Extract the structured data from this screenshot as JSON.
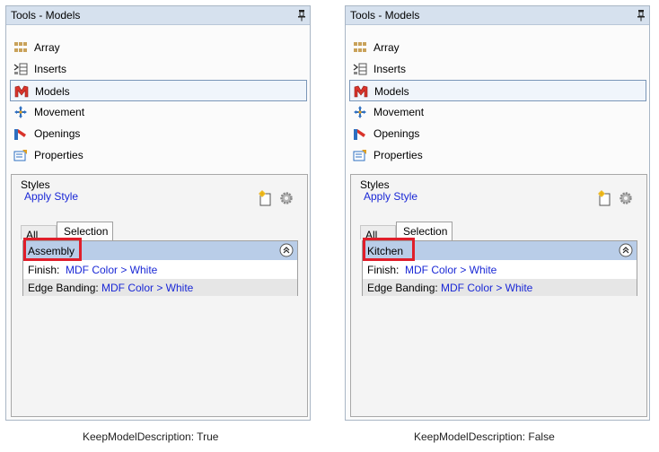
{
  "panels": [
    {
      "title": "Tools - Models",
      "menu": [
        "Array",
        "Inserts",
        "Models",
        "Movement",
        "Openings",
        "Properties"
      ],
      "selected_menu": "Models",
      "styles": {
        "label": "Styles",
        "apply_link": "Apply Style"
      },
      "tabs": {
        "all": "All",
        "selection": "Selection"
      },
      "group_header": "Assembly",
      "rows": [
        {
          "key": "Finish:",
          "value": "MDF Color > White"
        },
        {
          "key": "Edge Banding:",
          "value": "MDF Color > White"
        }
      ],
      "caption": "KeepModelDescription: True"
    },
    {
      "title": "Tools - Models",
      "menu": [
        "Array",
        "Inserts",
        "Models",
        "Movement",
        "Openings",
        "Properties"
      ],
      "selected_menu": "Models",
      "styles": {
        "label": "Styles",
        "apply_link": "Apply Style"
      },
      "tabs": {
        "all": "All",
        "selection": "Selection"
      },
      "group_header": "Kitchen",
      "rows": [
        {
          "key": "Finish:",
          "value": "MDF Color > White"
        },
        {
          "key": "Edge Banding:",
          "value": "MDF Color > White"
        }
      ],
      "caption": "KeepModelDescription: False"
    }
  ],
  "colors": {
    "highlight_box": "#e01e2a",
    "link": "#1a28d6",
    "header_bg": "#b9cde8"
  },
  "icons": [
    "array-icon",
    "inserts-icon",
    "models-icon",
    "movement-icon",
    "openings-icon",
    "properties-icon"
  ]
}
